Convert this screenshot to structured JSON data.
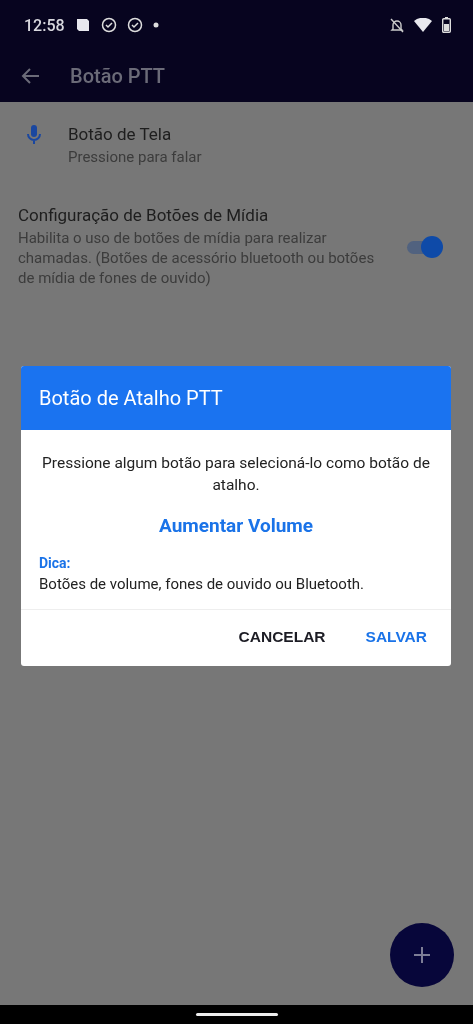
{
  "status_bar": {
    "time": "12:58"
  },
  "app_bar": {
    "title": "Botão PTT"
  },
  "settings": [
    {
      "kind": "action",
      "title": "Botão de Tela",
      "subtitle": "Pressione para falar"
    },
    {
      "kind": "toggle",
      "title": "Configuração de Botões de Mídia",
      "subtitle": "Habilita o uso de botões de mídia para realizar chamadas. (Botões de acessório bluetooth ou botões de mídia de fones de ouvido)",
      "on": true
    }
  ],
  "dialog": {
    "title": "Botão de Atalho PTT",
    "message": "Pressione algum botão para selecioná-lo como botão de atalho.",
    "selected_key": "Aumentar Volume",
    "hint_label": "Dica:",
    "hint": "Botões de volume, fones de ouvido ou Bluetooth.",
    "buttons": [
      {
        "label": "CANCELAR",
        "kind": "neutral"
      },
      {
        "label": "SALVAR",
        "kind": "primary"
      }
    ]
  }
}
